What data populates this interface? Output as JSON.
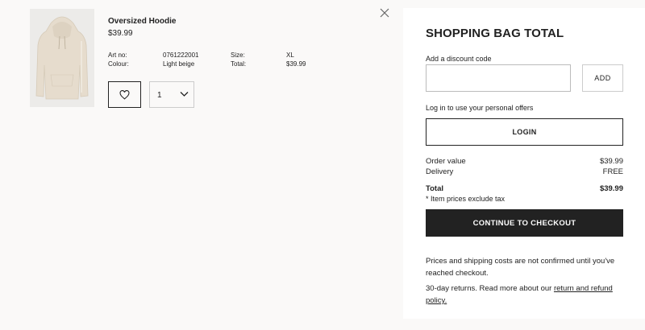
{
  "product": {
    "name": "Oversized Hoodie",
    "price": "$39.99",
    "art_label": "Art no:",
    "art_value": "0761222001",
    "colour_label": "Colour:",
    "colour_value": "Light beige",
    "size_label": "Size:",
    "size_value": "XL",
    "total_label": "Total:",
    "total_value": "$39.99",
    "quantity": "1",
    "image_color": "#e6dccd"
  },
  "summary": {
    "title": "SHOPPING BAG TOTAL",
    "discount_label": "Add a discount code",
    "discount_value": "",
    "add_label": "ADD",
    "login_prompt": "Log in to use your personal offers",
    "login_label": "LOGIN",
    "order_value_label": "Order value",
    "order_value": "$39.99",
    "delivery_label": "Delivery",
    "delivery_value": "FREE",
    "total_label": "Total",
    "total_value": "$39.99",
    "tax_note": "* Item prices exclude tax",
    "checkout_label": "CONTINUE TO CHECKOUT",
    "shipping_note": "Prices and shipping costs are not confirmed until you've reached checkout.",
    "returns_text": "30-day returns. Read more about our ",
    "returns_link": "return and refund policy."
  },
  "colors": {
    "page_bg": "#faf9f8",
    "panel_bg": "#ffffff",
    "checkout_bg": "#222222"
  },
  "icons": [
    "close-icon",
    "heart-icon",
    "chevron-down-icon",
    "hoodie-image"
  ]
}
